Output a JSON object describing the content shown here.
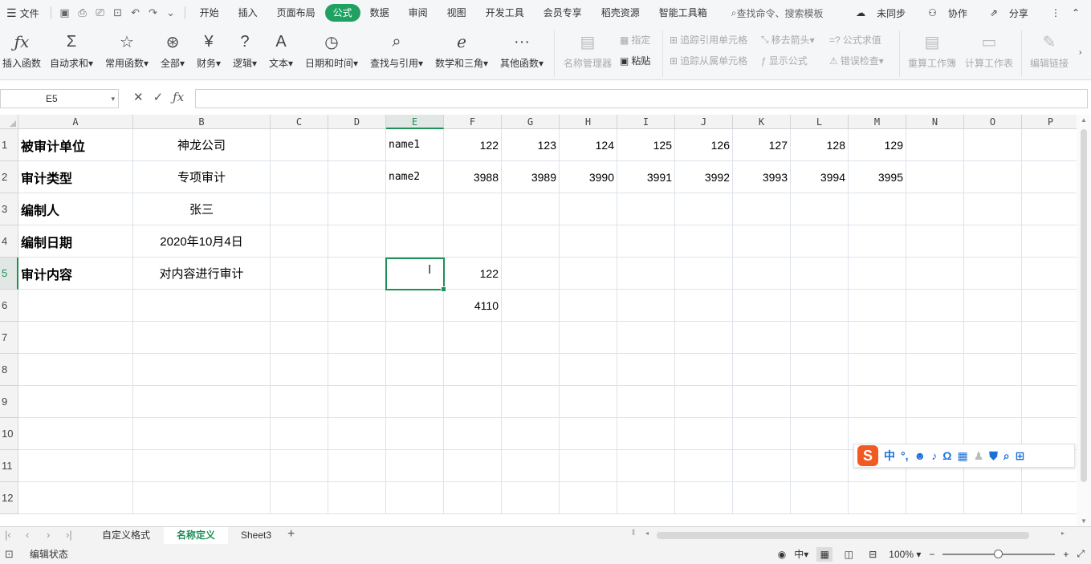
{
  "menubar": {
    "file_label": "文件",
    "tabs": [
      "开始",
      "插入",
      "页面布局",
      "公式",
      "数据",
      "审阅",
      "视图",
      "开发工具",
      "会员专享",
      "稻壳资源",
      "智能工具箱"
    ],
    "active_tab": "公式",
    "search_placeholder": "查找命令、搜索模板",
    "unsynced": "未同步",
    "collab": "协作",
    "share": "分享"
  },
  "ribbon": {
    "insert_function": "插入函数",
    "autosum": "自动求和",
    "common_functions": "常用函数",
    "all": "全部",
    "finance": "财务",
    "logic": "逻辑",
    "text": "文本",
    "datetime": "日期和时间",
    "lookup": "查找与引用",
    "math": "数学和三角",
    "other": "其他函数",
    "name_manager": "名称管理器",
    "specify": "指定",
    "paste": "粘贴",
    "trace_precedents": "追踪引用单元格",
    "trace_dependents": "追踪从属单元格",
    "remove_arrows": "移去箭头",
    "show_formulas": "显示公式",
    "eval_formula": "公式求值",
    "error_check": "错误检查",
    "recalc_workbook": "重算工作簿",
    "calc_sheet": "计算工作表",
    "edit_links": "编辑链接"
  },
  "formula_bar": {
    "name_box": "E5",
    "formula": ""
  },
  "columns": [
    "A",
    "B",
    "C",
    "D",
    "E",
    "F",
    "G",
    "H",
    "I",
    "J",
    "K",
    "L",
    "M",
    "N",
    "O",
    "P"
  ],
  "rows": [
    "1",
    "2",
    "3",
    "4",
    "5",
    "6",
    "7",
    "8",
    "9",
    "10",
    "11",
    "12"
  ],
  "cells": {
    "A1": "被审计单位",
    "B1": "神龙公司",
    "E1": "name1",
    "F1": "122",
    "G1": "123",
    "H1": "124",
    "I1": "125",
    "J1": "126",
    "K1": "127",
    "L1": "128",
    "M1": "129",
    "A2": "审计类型",
    "B2": "专项审计",
    "E2": "name2",
    "F2": "3988",
    "G2": "3989",
    "H2": "3990",
    "I2": "3991",
    "J2": "3992",
    "K2": "3993",
    "L2": "3994",
    "M2": "3995",
    "A3": "编制人",
    "B3": "张三",
    "A4": "编制日期",
    "B4": "2020年10月4日",
    "A5": "审计内容",
    "B5": "对内容进行审计",
    "F5": "122",
    "F6": "4110"
  },
  "sheets": [
    "自定义格式",
    "名称定义",
    "Sheet3"
  ],
  "active_sheet": "名称定义",
  "status": {
    "mode": "编辑状态",
    "zoom": "100%"
  },
  "ime": {
    "mode": "中"
  },
  "colors": {
    "accent": "#20a162",
    "selection": "#1e8f57",
    "ime_logo": "#f15a22"
  }
}
